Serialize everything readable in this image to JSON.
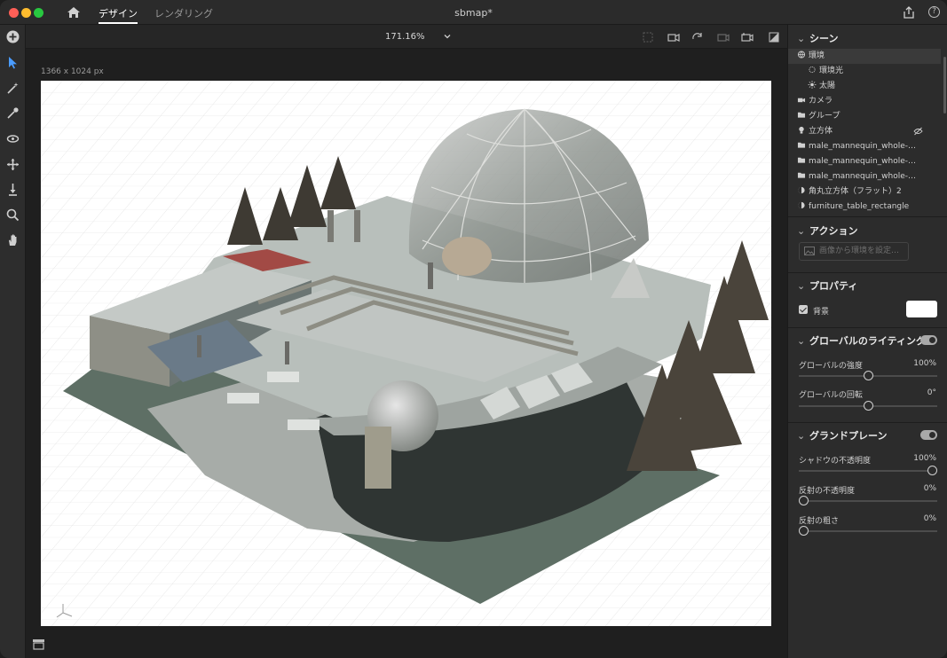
{
  "window": {
    "tabs": [
      "デザイン",
      "レンダリング"
    ],
    "doc_title": "sbmap*"
  },
  "canvas": {
    "zoom": "171.16%",
    "artboard_size": "1366 x 1024 px"
  },
  "panel": {
    "scene": {
      "title": "シーン",
      "items": [
        {
          "label": "環境",
          "icon": "globe-icon"
        },
        {
          "label": "環境光",
          "icon": "ambient-light-icon"
        },
        {
          "label": "太陽",
          "icon": "sun-icon"
        },
        {
          "label": "カメラ",
          "icon": "camera-icon"
        },
        {
          "label": "グループ",
          "icon": "folder-icon"
        },
        {
          "label": "立方体",
          "icon": "light-object-icon"
        },
        {
          "label": "male_mannequin_whole-…",
          "icon": "folder-icon"
        },
        {
          "label": "male_mannequin_whole-…",
          "icon": "folder-icon"
        },
        {
          "label": "male_mannequin_whole-…",
          "icon": "folder-icon"
        },
        {
          "label": "角丸立方体（フラット）2",
          "icon": "material-icon"
        },
        {
          "label": "furniture_table_rectangle",
          "icon": "material-icon"
        }
      ]
    },
    "actions": {
      "title": "アクション",
      "button": "画像から環境を設定…"
    },
    "properties": {
      "title": "プロパティ",
      "background_label": "背景",
      "background_color": "#ffffff"
    },
    "global_lighting": {
      "title": "グローバルのライティング",
      "intensity_label": "グローバルの強度",
      "intensity_value": "100%",
      "intensity": 0.5,
      "rotation_label": "グローバルの回転",
      "rotation_value": "0°",
      "rotation": 0.5
    },
    "ground_plane": {
      "title": "グランドプレーン",
      "shadow_opacity_label": "シャドウの不透明度",
      "shadow_opacity_value": "100%",
      "shadow_opacity": 1.0,
      "reflection_opacity_label": "反射の不透明度",
      "reflection_opacity_value": "0%",
      "reflection_opacity": 0,
      "reflection_roughness_label": "反射の粗さ",
      "reflection_roughness_value": "0%",
      "reflection_roughness": 0
    }
  }
}
